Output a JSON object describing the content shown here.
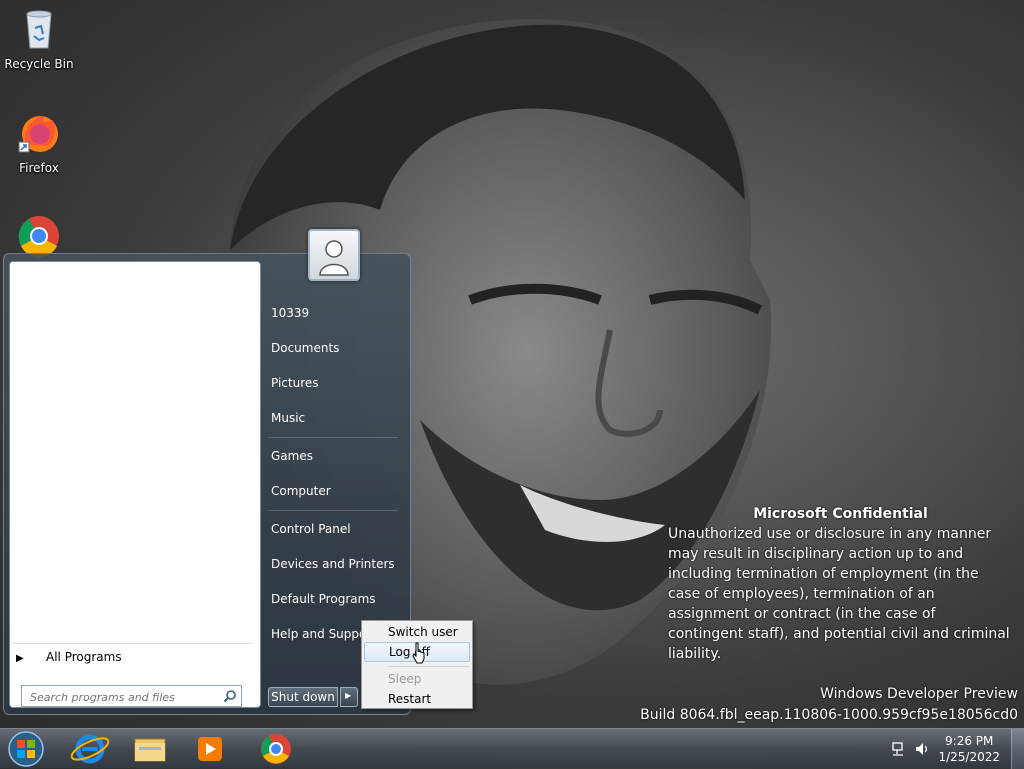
{
  "desktop": {
    "icons": [
      {
        "label": "Recycle Bin",
        "icon": "recycle-bin-icon"
      },
      {
        "label": "Firefox",
        "icon": "firefox-icon"
      },
      {
        "label": "",
        "icon": "chrome-icon"
      }
    ]
  },
  "start_menu": {
    "right_items": [
      {
        "label": "10339"
      },
      {
        "label": "Documents"
      },
      {
        "label": "Pictures"
      },
      {
        "label": "Music"
      },
      {
        "label": "Games"
      },
      {
        "label": "Computer"
      },
      {
        "label": "Control Panel"
      },
      {
        "label": "Devices and Printers"
      },
      {
        "label": "Default Programs"
      },
      {
        "label": "Help and Support"
      }
    ],
    "all_programs": "All Programs",
    "search_placeholder": "Search programs and files",
    "shutdown_label": "Shut down"
  },
  "power_menu": {
    "items": [
      {
        "label": "Switch user"
      },
      {
        "label": "Log off"
      },
      {
        "label": "Sleep",
        "disabled": true
      },
      {
        "label": "Restart"
      }
    ]
  },
  "watermark": {
    "title": "Microsoft Confidential",
    "body": "Unauthorized use or disclosure in any manner may result in disciplinary action up to and including termination of employment (in the case of employees), termination of an assignment or contract (in the case of contingent staff), and potential civil and criminal liability.",
    "product": "Windows Developer Preview",
    "build": "Build 8064.fbl_eeap.110806-1000.959cf95e18056cd0"
  },
  "taskbar": {
    "pinned": [
      "start-orb-icon",
      "internet-explorer-icon",
      "file-explorer-icon",
      "media-player-icon",
      "chrome-icon"
    ],
    "time": "9:26 PM",
    "date": "1/25/2022"
  }
}
